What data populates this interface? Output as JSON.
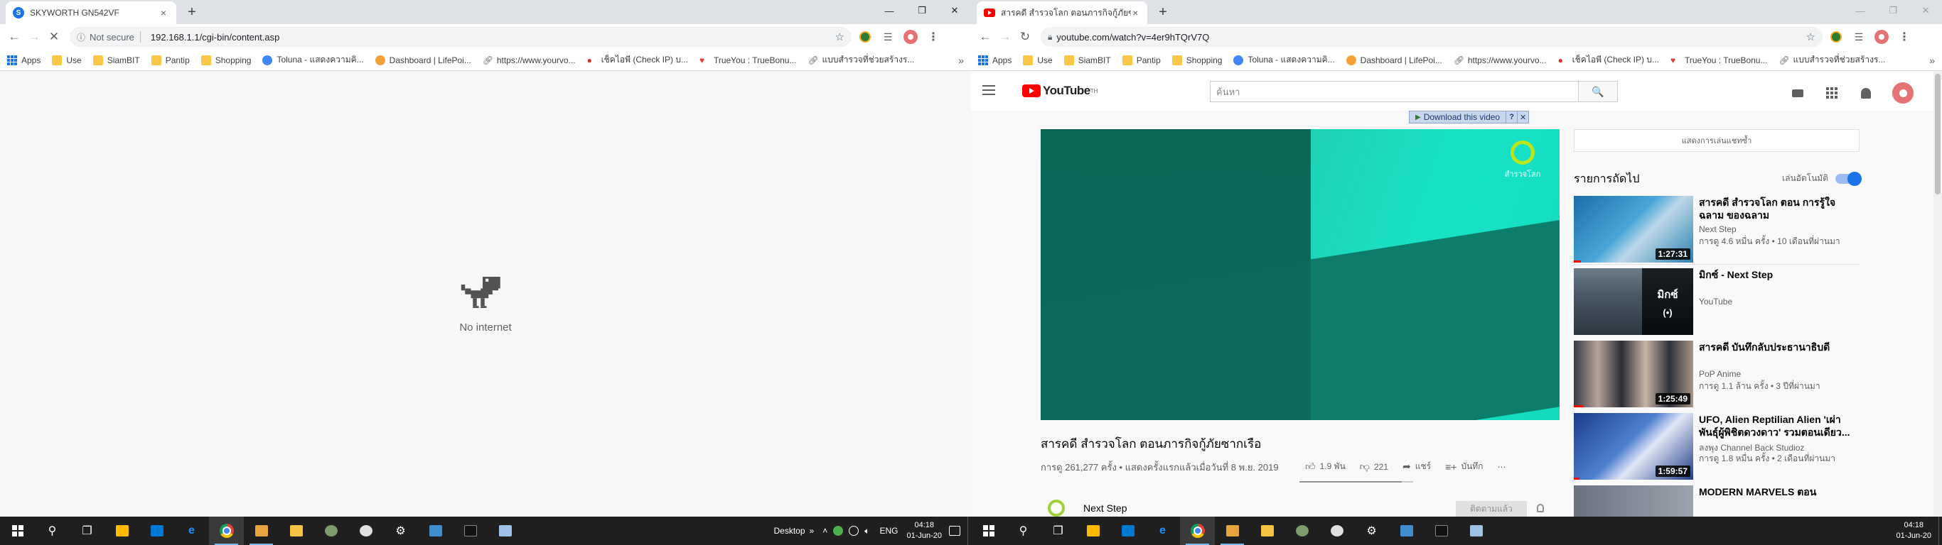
{
  "left": {
    "tab": {
      "title": "SKYWORTH GN542VF",
      "close": "×"
    },
    "new_tab": "+",
    "window_controls": {
      "minimize": "—",
      "maximize": "❐",
      "close": "✕"
    },
    "toolbar": {
      "back": "←",
      "forward": "→",
      "reload": "✕",
      "security_label": "Not secure",
      "url": "192.168.1.1/cgi-bin/content.asp"
    },
    "content": {
      "message": "No internet"
    }
  },
  "right": {
    "tab": {
      "title": "สารคดี สำรวจโลก ตอนภารกิจกู้ภัยซากเรือ",
      "close": "×"
    },
    "new_tab": "+",
    "window_controls": {
      "minimize": "—",
      "maximize": "❐",
      "close": "✕"
    },
    "toolbar": {
      "back": "←",
      "forward": "→",
      "reload": "↻",
      "url": "youtube.com/watch?v=4er9hTQrV7Q"
    },
    "youtube": {
      "logo_text": "YouTube",
      "logo_sup": "TH",
      "search_placeholder": "ค้นหา",
      "search_button": "🔍",
      "download": {
        "label": "Download this video",
        "help": "?",
        "close": "✕"
      },
      "player_watermark": "สำรวจโลก",
      "video_title": "สารคดี สำรวจโลก ตอนภารกิจกู้ภัยซากเรือ",
      "video_meta": "การดู 261,277 ครั้ง • แสดงครั้งแรกแล้วเมื่อวันที่ 8 พ.ย. 2019",
      "likes": "1.9 พัน",
      "dislikes": "221",
      "share": "แชร์",
      "save": "บันทึก",
      "more": "⋯",
      "like_ratio": 0.9,
      "channel_name": "Next Step",
      "subscribe": "ติดตามแล้ว",
      "chat_replay": "แสดงการเล่นแชทซ้ำ",
      "up_next": "รายการถัดไป",
      "autoplay": "เล่นอัตโนมัติ",
      "recommended": [
        {
          "title": "สารคดี สำรวจโลก ตอน การรู้ใจฉลาม ของฉลาม",
          "channel": "Next Step",
          "meta": "การดู 4.6 หมื่น ครั้ง • 10 เดือนที่ผ่านมา",
          "duration": "1:27:31",
          "progress": 0.06
        },
        {
          "title": "มิกซ์ - Next Step",
          "channel": "YouTube",
          "meta": "",
          "overlay": "มิกซ์",
          "overlay_icon": "(•)"
        },
        {
          "title": "สารคดี บันทึกลับประธานาธิบดี",
          "channel": "PoP Anime",
          "meta": "การดู 1.1 ล้าน ครั้ง • 3 ปีที่ผ่านมา",
          "duration": "1:25:49",
          "progress": 0.08
        },
        {
          "title": "UFO, Alien Reptilian Alien 'เผ่าพันธุ์ผู้พิชิตดวงดาว' รวมตอนเดียว...",
          "channel": "ลงพุง Channel Back Studioz",
          "meta": "การดู 1.8 หมื่น ครั้ง • 2 เดือนที่ผ่านมา",
          "duration": "1:59:57",
          "progress": 0.05
        },
        {
          "title": "MODERN MARVELS ตอน",
          "channel": "",
          "meta": ""
        }
      ]
    }
  },
  "bookmarks": [
    {
      "label": "Apps",
      "icon": "apps-icon"
    },
    {
      "label": "Use",
      "icon": "folder-icon"
    },
    {
      "label": "SiamBIT",
      "icon": "folder-icon"
    },
    {
      "label": "Pantip",
      "icon": "folder-icon"
    },
    {
      "label": "Shopping",
      "icon": "folder-icon"
    },
    {
      "label": "Toluna - แสดงความคิ...",
      "icon": "globe-icon"
    },
    {
      "label": "Dashboard | LifePoi...",
      "icon": "lifepoints-icon"
    },
    {
      "label": "https://www.yourvo...",
      "icon": "link-icon"
    },
    {
      "label": "เช็คไอพี (Check IP) บ...",
      "icon": "pin-icon"
    },
    {
      "label": "TrueYou : TrueBonu...",
      "icon": "heart-icon"
    },
    {
      "label": "แบบสำรวจที่ช่วยสร้างร...",
      "icon": "link-icon"
    }
  ],
  "bookmarks_more": "»",
  "taskbar": {
    "desktop_label": "Desktop",
    "chevrons": "»",
    "language": "ENG",
    "time": "04:18",
    "date": "01-Jun-20",
    "colors": {
      "mail": "#0078d4",
      "edge": "#1e90ff",
      "store": "#ffb900",
      "folder": "#f6c344"
    }
  }
}
